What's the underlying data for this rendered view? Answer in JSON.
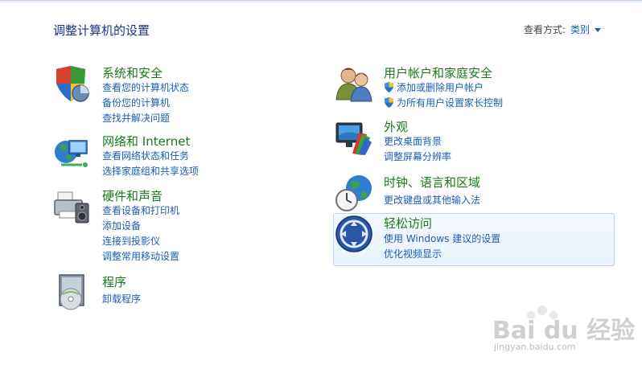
{
  "header": {
    "title": "调整计算机的设置",
    "view_by_label": "查看方式:",
    "view_by_value": "类别"
  },
  "left_column": [
    {
      "title": "系统和安全",
      "icon": "shield-computer-icon",
      "links": [
        "查看您的计算机状态",
        "备份您的计算机",
        "查找并解决问题"
      ]
    },
    {
      "title": "网络和 Internet",
      "icon": "network-globe-icon",
      "links": [
        "查看网络状态和任务",
        "选择家庭组和共享选项"
      ]
    },
    {
      "title": "硬件和声音",
      "icon": "printer-speaker-icon",
      "links": [
        "查看设备和打印机",
        "添加设备",
        "连接到投影仪",
        "调整常用移动设置"
      ]
    },
    {
      "title": "程序",
      "icon": "programs-disc-icon",
      "links": [
        "卸载程序"
      ]
    }
  ],
  "right_column": [
    {
      "title": "用户帐户和家庭安全",
      "icon": "users-icon",
      "links": [
        "添加或删除用户帐户",
        "为所有用户设置家长控制"
      ]
    },
    {
      "title": "外观",
      "icon": "monitor-palette-icon",
      "links": [
        "更改桌面背景",
        "调整屏幕分辨率"
      ]
    },
    {
      "title": "时钟、语言和区域",
      "icon": "clock-globe-icon",
      "links": [
        "更改键盘或其他输入法"
      ]
    },
    {
      "title": "轻松访问",
      "icon": "ease-of-access-icon",
      "links": [
        "使用 Windows 建议的设置",
        "优化视频显示"
      ]
    }
  ],
  "watermark": {
    "logo": "Bai du 经验",
    "url": "jingyan.baidu.com"
  }
}
